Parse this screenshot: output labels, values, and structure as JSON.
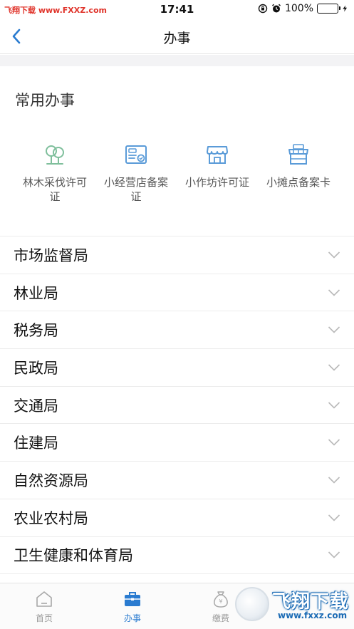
{
  "status_bar": {
    "watermark": "飞翔下载 www.FXXZ.com",
    "time": "17:41",
    "battery_text": "100%",
    "battery_color": "#39c249"
  },
  "nav": {
    "back_icon": "chevron-left-icon",
    "title": "办事"
  },
  "common": {
    "title": "常用办事",
    "items": [
      {
        "label": "林木采伐许可证",
        "icon": "tree-icon"
      },
      {
        "label": "小经营店备案证",
        "icon": "certificate-icon"
      },
      {
        "label": "小作坊许可证",
        "icon": "shop-icon"
      },
      {
        "label": "小摊点备案卡",
        "icon": "stall-icon"
      }
    ]
  },
  "departments": [
    "市场监督局",
    "林业局",
    "税务局",
    "民政局",
    "交通局",
    "住建局",
    "自然资源局",
    "农业农村局",
    "卫生健康和体育局"
  ],
  "tabs": [
    {
      "label": "首页",
      "icon": "home-icon",
      "active": false
    },
    {
      "label": "办事",
      "icon": "briefcase-icon",
      "active": true
    },
    {
      "label": "缴费",
      "icon": "money-bag-icon",
      "active": false
    }
  ],
  "watermark_logo": {
    "text": "飞翔下载",
    "url": "www.fxxz.com"
  },
  "colors": {
    "accent": "#2a7bd0",
    "icon_green": "#7fbf9c",
    "icon_blue": "#5a9bd8"
  }
}
